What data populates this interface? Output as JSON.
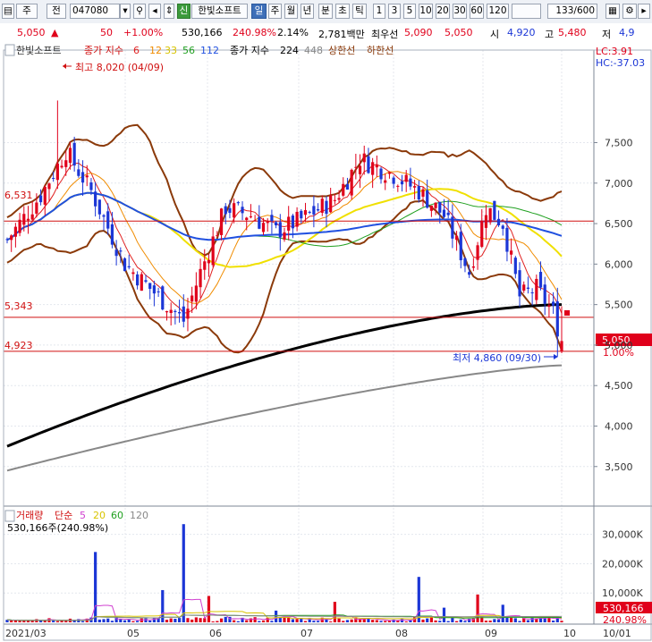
{
  "toolbar": {
    "mode": "주",
    "prev": "전",
    "code": "047080",
    "badge": "신",
    "name": "한빛소프트",
    "period_active": "일",
    "periods": [
      "주",
      "월",
      "년",
      "분",
      "초",
      "틱"
    ],
    "numbers": [
      "1",
      "3",
      "5",
      "10",
      "20",
      "30",
      "60",
      "120"
    ],
    "count": "133/600"
  },
  "quote": {
    "price": "5,050",
    "arrow": "▲",
    "change": "50",
    "change_pct": "+1.00%",
    "volume": "530,166",
    "volume_ratio": "240.98%",
    "turnover": "2.14%",
    "amount": "2,781백만",
    "best_bid_label": "최우선",
    "best_ask": "5,090",
    "best_bid": "5,050",
    "open_label": "시",
    "open": "4,920",
    "high_label": "고",
    "high": "5,480",
    "low_label": "저",
    "low": "4,9"
  },
  "legend": {
    "name": "한빛소프트",
    "ma_label": "종가 지수",
    "ma": [
      "6",
      "12",
      "33",
      "56",
      "112"
    ],
    "ma_long_label": "종가 지수",
    "ma_long": [
      "224",
      "448"
    ],
    "upper_band": "상한선",
    "lower_band": "하한선",
    "lc": "LC:3.91",
    "hc": "HC:-37.03"
  },
  "annotations": {
    "max": "최고 8,020 (04/09)",
    "min": "최저 4,860 (09/30)",
    "h_line_1": "6,531",
    "h_line_2": "5,343",
    "h_line_3": "4,923",
    "current_price": "5,050",
    "current_pct": "1.00%"
  },
  "volume_legend": {
    "title": "거래량",
    "ma_label": "단순",
    "ma": [
      "5",
      "20",
      "60",
      "120"
    ],
    "current": "530,166주(240.98%)",
    "badge_value": "530,166",
    "badge_pct": "240.98%"
  },
  "colors": {
    "up": "#e0001b",
    "down": "#1b36d6",
    "ma6": "#e02020",
    "ma12": "#f08c00",
    "ma33": "#f0e000",
    "ma56": "#20a020",
    "ma112": "#2050e0",
    "ma224": "#000000",
    "ma448": "#888888",
    "band": "#8b3a0a",
    "hline": "#d01010"
  },
  "chart_data": {
    "type": "candlestick",
    "title": "한빛소프트",
    "x_labels": [
      "2021/03",
      "05",
      "06",
      "07",
      "08",
      "09",
      "10",
      "10/01"
    ],
    "price_axis": {
      "ticks": [
        "7,500",
        "7,000",
        "6,500",
        "6,000",
        "5,500",
        "5,000",
        "4,500",
        "4,000",
        "3,500"
      ],
      "ylim": [
        3100,
        8400
      ]
    },
    "volume_axis": {
      "ticks": [
        "30,000K",
        "20,000K",
        "10,000K"
      ],
      "ylim": [
        0,
        36000
      ]
    },
    "horizontal_lines": [
      6531,
      5343,
      4923
    ],
    "highest": {
      "value": 8020,
      "date": "04/09"
    },
    "lowest": {
      "value": 4860,
      "date": "09/30"
    },
    "last": {
      "close": 5050,
      "open": 4920,
      "high": 5480,
      "low": 4900,
      "volume_k": 530
    }
  }
}
